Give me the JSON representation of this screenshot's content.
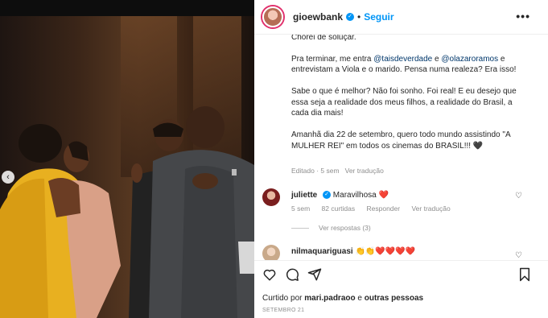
{
  "post": {
    "username": "gioewbank",
    "follow_label": "Seguir",
    "more_label": "•••",
    "caption": {
      "p1": "assistir \"A Mulher Rei\". Que filme, que elenco, que história. Chorei de soluçar.",
      "p2_a": "Pra terminar, me entra ",
      "p2_mention1": "@taisdeverdade",
      "p2_b": " e ",
      "p2_mention2": "@olazaroramos",
      "p2_c": " e entrevistam a Viola e o marido. Pensa numa realeza? Era isso!",
      "p3": "Sabe o que é melhor? Não foi sonho. Foi real! E eu desejo que essa seja a realidade dos meus filhos, a realidade do Brasil, a cada dia mais!",
      "p4": "Amanhã dia 22 de setembro, quero todo mundo assistindo \"A MULHER REI\" em todos os cinemas do BRASIL!!! 🖤"
    },
    "caption_meta": "Editado · 5 sem",
    "caption_translate": "Ver tradução"
  },
  "comments": [
    {
      "username": "juliette",
      "text": "Maravilhosa ❤️",
      "age": "5 sem",
      "likes": "82 curtidas",
      "reply": "Responder",
      "translate": "Ver tradução",
      "avatar_color": "#7a1e1e"
    },
    {
      "username": "nilmaquariguasi",
      "text": "👏👏❤️❤️❤️❤️",
      "avatar_color": "#c9a98a"
    }
  ],
  "replies_label": "Ver respostas (3)",
  "liked_by": {
    "prefix": "Curtido por ",
    "user": "mari.padraoo",
    "middle": " e ",
    "others": "outras pessoas"
  },
  "date": "SETEMBRO 21",
  "colors": {
    "accent": "#0095f6",
    "link": "#00376b",
    "muted": "#8e8e8e",
    "heart": "#ed4956"
  }
}
